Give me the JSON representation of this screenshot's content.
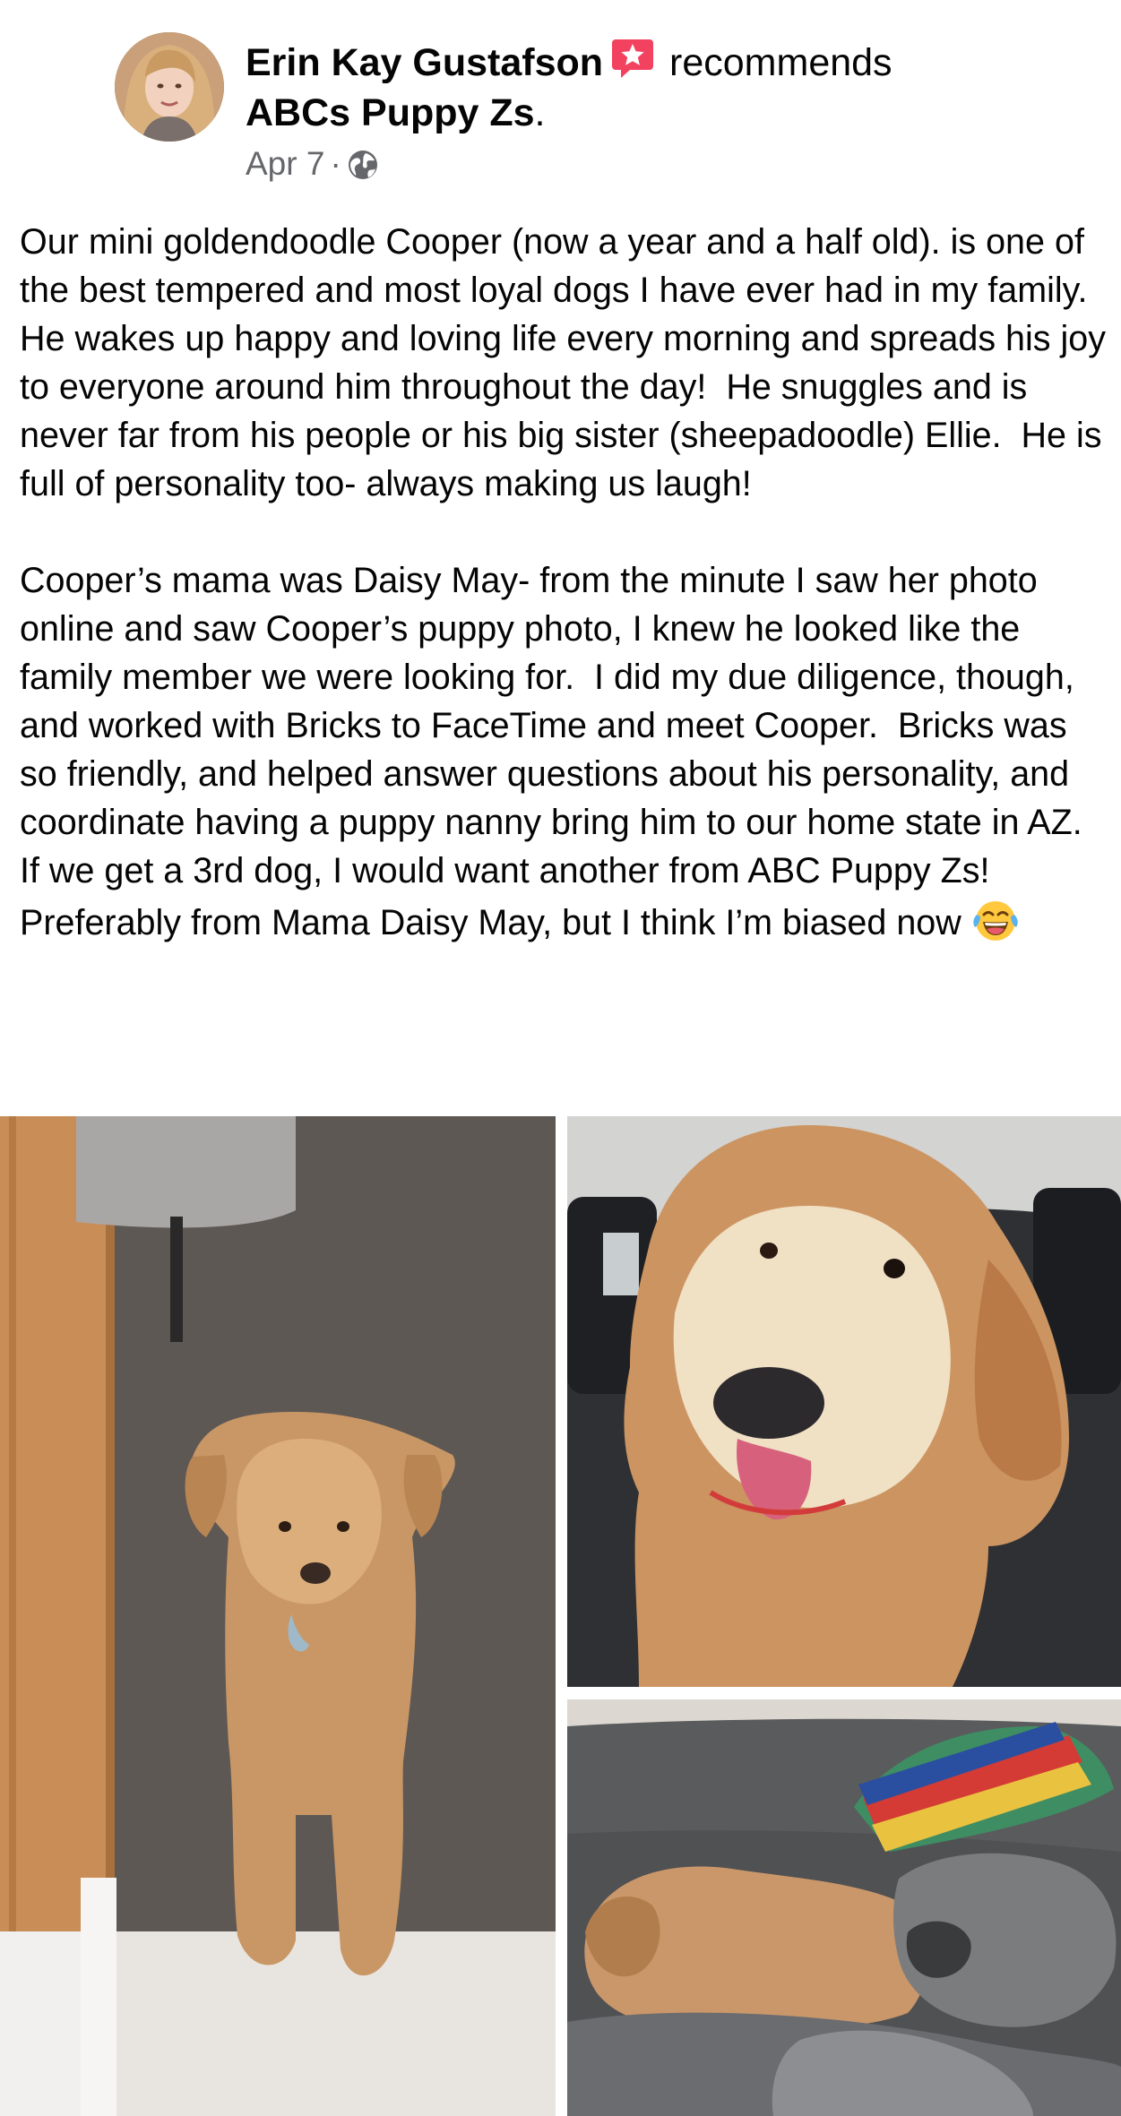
{
  "post": {
    "author": "Erin Kay Gustafson",
    "action": "recommends",
    "page_name": "ABCs Puppy Zs",
    "page_suffix": ".",
    "date": "Apr 7",
    "separator": "·",
    "privacy_icon": "globe-icon",
    "badge_icon": "recommend-star-icon",
    "body": "Our mini goldendoodle Cooper (now a year and a half old). is one of the best tempered and most loyal dogs I have ever had in my family.  He wakes up happy and loving life every morning and spreads his joy to everyone around him throughout the day!  He snuggles and is never far from his people or his big sister (sheepadoodle) Ellie.  He is full of personality too- always making us laugh!\n\nCooper’s mama was Daisy May- from the minute I saw her photo online and saw Cooper’s puppy photo, I knew he looked like the family member we were looking for.  I did my due diligence, though, and worked with Bricks to FaceTime and meet Cooper.  Bricks was so friendly, and helped answer questions about his personality, and coordinate having a puppy nanny bring him to our home state in AZ.  If we get a 3rd dog, I would want another from ABC Puppy Zs!  Preferably from Mama Daisy May, but I think I’m biased now",
    "body_emoji": "laughing-tears-emoji"
  },
  "colors": {
    "text": "#050505",
    "meta": "#65676b",
    "badge": "#f3425f",
    "background": "#ffffff"
  }
}
